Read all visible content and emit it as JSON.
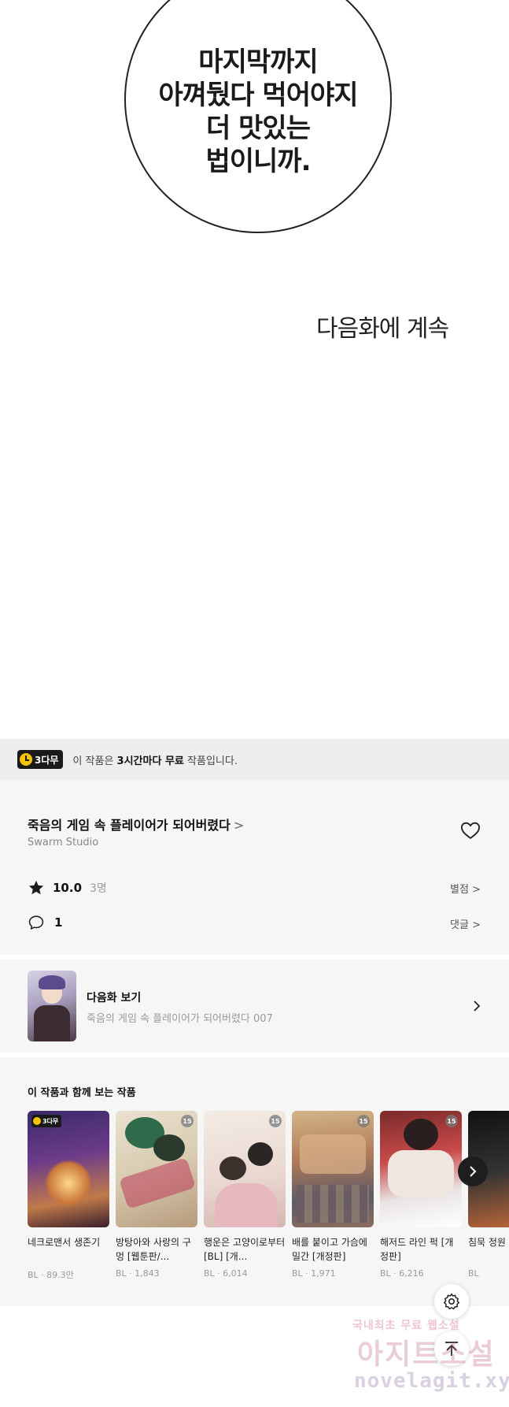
{
  "comic": {
    "bubble_lines": [
      "마지막까지",
      "아껴뒀다 먹어야지",
      "더 맛있는",
      "법이니까."
    ],
    "to_be_continued": "다음화에 계속"
  },
  "banner": {
    "badge_label": "3다무",
    "text_prefix": "이 작품은 ",
    "text_bold": "3시간마다 무료",
    "text_suffix": " 작품입니다."
  },
  "work": {
    "title": "죽음의 게임 속 플레이어가 되어버렸다",
    "title_chevron": ">",
    "studio": "Swarm Studio",
    "rating": "10.0",
    "rating_count": "3명",
    "rating_link": "별점 >",
    "comment_count": "1",
    "comment_link": "댓글 >"
  },
  "next_episode": {
    "label": "다음화 보기",
    "subtitle": "죽음의 게임 속 플레이어가 되어버렸다 007"
  },
  "recommendations": {
    "heading": "이 작품과 함께 보는 작품",
    "items": [
      {
        "title": "네크로맨서 생존기",
        "meta": "BL · 89.3만",
        "badge": "3다무",
        "age": ""
      },
      {
        "title": "방탕아와 사랑의 구멍 [웹툰판/...",
        "meta": "BL · 1,843",
        "badge": "",
        "age": "15"
      },
      {
        "title": "행운은 고양이로부터 [BL] [개...",
        "meta": "BL · 6,014",
        "badge": "",
        "age": "15"
      },
      {
        "title": "배를 붙이고 가슴에 밀간 [개정판]",
        "meta": "BL · 1,971",
        "badge": "",
        "age": "15"
      },
      {
        "title": "해저드 라인 퍽 [개정판]",
        "meta": "BL · 6,216",
        "badge": "",
        "age": "15"
      },
      {
        "title": "침묵 정원",
        "meta": "BL",
        "badge": "",
        "age": ""
      }
    ]
  },
  "watermark": {
    "line1": "국내최초 무료 웹소설",
    "line2": "아지트소설",
    "line3": "novelagit.xyz"
  },
  "colors": {
    "accent_yellow": "#f5c400",
    "panel_bg": "#f6f6f6",
    "banner_bg": "#eeeeee"
  }
}
